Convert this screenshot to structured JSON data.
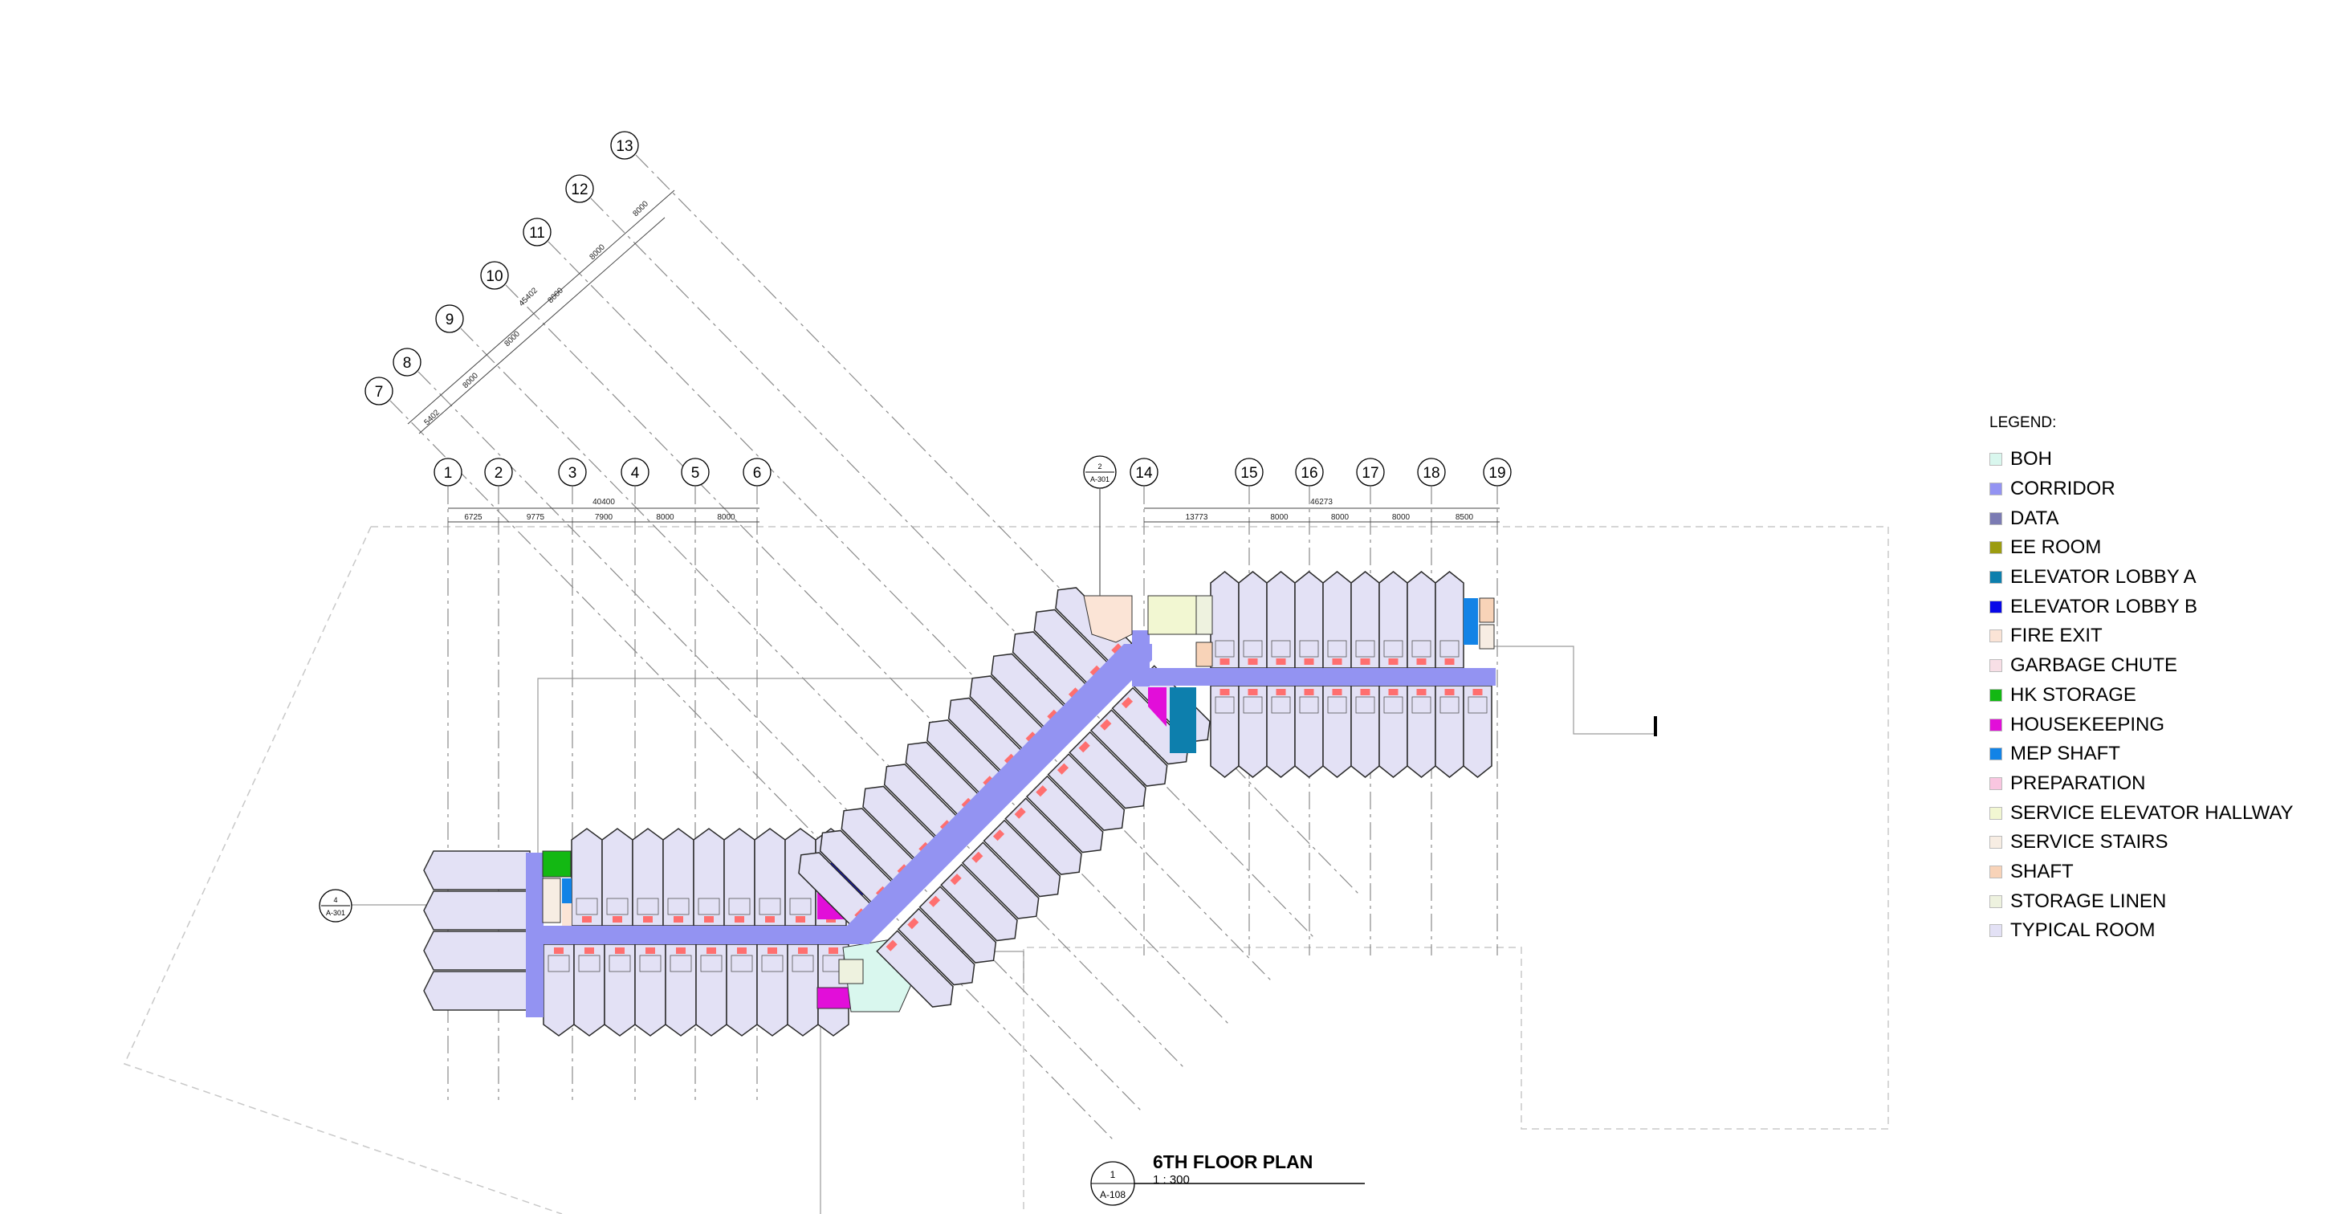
{
  "legend": {
    "title": "LEGEND:",
    "items": [
      {
        "label": "BOH",
        "color": "#d9f7ee"
      },
      {
        "label": "CORRIDOR",
        "color": "#9393f2"
      },
      {
        "label": "DATA",
        "color": "#7b7bb3"
      },
      {
        "label": "EE ROOM",
        "color": "#9c9c10"
      },
      {
        "label": "ELEVATOR LOBBY A",
        "color": "#0d7fad"
      },
      {
        "label": "ELEVATOR LOBBY B",
        "color": "#0707e8"
      },
      {
        "label": "FIRE EXIT",
        "color": "#fbe4d6"
      },
      {
        "label": "GARBAGE CHUTE",
        "color": "#f8dfe6"
      },
      {
        "label": "HK STORAGE",
        "color": "#13b813"
      },
      {
        "label": "HOUSEKEEPING",
        "color": "#e20ed9"
      },
      {
        "label": "MEP SHAFT",
        "color": "#1283e6"
      },
      {
        "label": "PREPARATION",
        "color": "#f9c6e0"
      },
      {
        "label": "SERVICE ELEVATOR HALLWAY",
        "color": "#f2f7d2"
      },
      {
        "label": "SERVICE STAIRS",
        "color": "#f7ede3"
      },
      {
        "label": "SHAFT",
        "color": "#f8d3b8"
      },
      {
        "label": "STORAGE LINEN",
        "color": "#eef2df"
      },
      {
        "label": "TYPICAL ROOM",
        "color": "#e3e1f5"
      }
    ]
  },
  "drawing": {
    "title": "6TH FLOOR PLAN",
    "scale": "1 : 300",
    "view_number": "1",
    "sheet": "A-108"
  },
  "grid": {
    "straight_left_labels": [
      "1",
      "2",
      "3",
      "4",
      "5",
      "6"
    ],
    "straight_left_total": "40400",
    "straight_left_spacings": [
      "6725",
      "9775",
      "7900",
      "8000",
      "8000"
    ],
    "straight_right_labels": [
      "14",
      "15",
      "16",
      "17",
      "18",
      "19"
    ],
    "straight_right_total": "46273",
    "straight_right_spacings": [
      "13773",
      "8000",
      "8000",
      "8000",
      "8500"
    ],
    "diagonal_labels": [
      "7",
      "8",
      "9",
      "10",
      "11",
      "12",
      "13"
    ],
    "diagonal_total": "45402",
    "diagonal_spacings": [
      "5402",
      "8000",
      "8000",
      "8000",
      "8000",
      "8000"
    ]
  },
  "section_markers": [
    {
      "number": "2",
      "sheet": "A-301"
    },
    {
      "number": "4",
      "sheet": "A-301"
    }
  ]
}
